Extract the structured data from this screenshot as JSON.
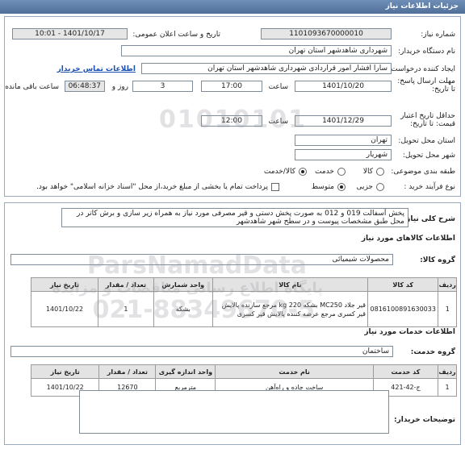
{
  "window": {
    "title": "جزئیات اطلاعات نیاز"
  },
  "form": {
    "need_number": {
      "label": "شماره نیاز:",
      "value": "1101093670000010"
    },
    "announce_datetime": {
      "label": "تاریخ و ساعت اعلان عمومی:",
      "value": "1401/10/17 - 10:01"
    },
    "buyer_org": {
      "label": "نام دستگاه خریدار:",
      "value": "شهرداری شاهدشهر استان تهران"
    },
    "requester": {
      "label": "ایجاد کننده درخواست:",
      "value": "سارا افشار امور قراردادی شهرداری شاهدشهر استان تهران",
      "contact_link": "اطلاعات تماس خریدار"
    },
    "deadline": {
      "label": "مهلت ارسال پاسخ: تا تاریخ:",
      "date": "1401/10/20",
      "time_label": "ساعت",
      "time": "17:00",
      "days": "3",
      "days_label": "روز و",
      "remaining": "06:48:37",
      "remaining_label": "ساعت باقی مانده"
    },
    "price_validity": {
      "label": "حداقل تاریخ اعتبار قیمت: تا تاریخ:",
      "date": "1401/12/29",
      "time_label": "ساعت",
      "time": "12:00"
    },
    "delivery_province": {
      "label": "استان محل تحویل:",
      "value": "تهران"
    },
    "delivery_city": {
      "label": "شهر محل تحویل:",
      "value": "شهریار"
    },
    "category": {
      "label": "طبقه بندی موضوعی:",
      "options": [
        "کالا",
        "خدمت",
        "کالا/خدمت"
      ],
      "selected": "کالا/خدمت"
    },
    "purchase_process": {
      "label": "نوع فرآیند خرید :",
      "options": [
        "جزیی",
        "متوسط"
      ],
      "selected": "متوسط",
      "treasury_note": "پرداخت تمام یا بخشی از مبلغ خرید،از محل \"اسناد خزانه اسلامی\" خواهد بود."
    }
  },
  "summary": {
    "label": "شرح کلی نیاز:",
    "text": "پخش آسفالت 019 و 012 به صورت پخش دستی و قیر مصرفی مورد نیاز به همراه زیر سازی و برش کاتر در محل طبق مشخصات پیوست و در سطح شهر شاهدشهر"
  },
  "goods": {
    "section_title": "اطلاعات کالاهای مورد نیاز",
    "group_label": "گروه کالا:",
    "group_value": "محصولات شیمیائی",
    "columns": [
      "ردیف",
      "کد کالا",
      "نام کالا",
      "واحد شمارش",
      "تعداد / مقدار",
      "تاریخ نیاز"
    ],
    "rows": [
      {
        "row": "1",
        "code": "0816100891630033",
        "name": "قیر جلاد MC250 بشکه 220 kg مرجع سازنده پالایش قیر کسری مرجع عرضه کننده پالایش قیر کسری",
        "unit": "بشکه",
        "qty": "1",
        "date": "1401/10/22"
      }
    ]
  },
  "services": {
    "section_title": "اطلاعات خدمات مورد نیاز",
    "group_label": "گروه خدمت:",
    "group_value": "ساختمان",
    "columns": [
      "ردیف",
      "کد خدمت",
      "نام خدمت",
      "واحد اندازه گیری",
      "تعداد / مقدار",
      "تاریخ نیاز"
    ],
    "rows": [
      {
        "row": "1",
        "code": "ج-42-421",
        "name": "ساخت جاده و راه‌آهن",
        "unit": "مترمربع",
        "qty": "12670",
        "date": "1401/10/22"
      }
    ]
  },
  "buyer_notes": {
    "label": "توضیحات خریدار:",
    "value": ""
  },
  "watermark": {
    "brand": "ParsNamadData",
    "tagline": "پایگاه اطلاع رسانی مناقصات و مزایده",
    "phone": "021-88349670-5"
  }
}
